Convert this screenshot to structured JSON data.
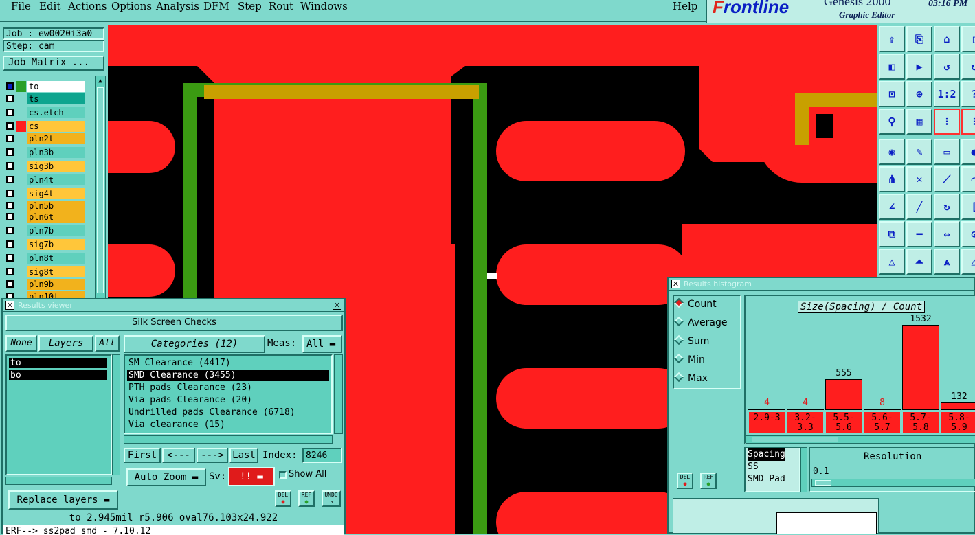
{
  "menu": [
    "File",
    "Edit",
    "Actions",
    "Options",
    "Analysis",
    "DFM",
    "Step",
    "Rout",
    "Windows"
  ],
  "help": "Help",
  "brand": {
    "logo_prefix": "F",
    "logo_rest": "rontline",
    "product": "Genesis 2000",
    "subtitle": "Graphic Editor",
    "time": "03:16 PM"
  },
  "job": {
    "job_label": "Job : ew0020i3a0",
    "step_label": "Step: cam",
    "matrix_button": "Job Matrix ..."
  },
  "layers": [
    {
      "name": "to",
      "color": "#ffffff",
      "swatch": "#2aa02a",
      "active": true
    },
    {
      "name": "ts",
      "color": "#0ea58f",
      "swatch": ""
    },
    {
      "name": "cs.etch",
      "color": "#5fd0bd",
      "swatch": ""
    },
    {
      "name": "cs",
      "color": "#ffc63a",
      "swatch": "#ff1e1e"
    },
    {
      "name": "pln2t",
      "color": "#f2b21c",
      "swatch": ""
    },
    {
      "name": "pln3b",
      "color": "#5fd0bd",
      "swatch": ""
    },
    {
      "name": "sig3b",
      "color": "#ffc63a",
      "swatch": ""
    },
    {
      "name": "pln4t",
      "color": "#5fd0bd",
      "swatch": ""
    },
    {
      "name": "sig4t",
      "color": "#ffc63a",
      "swatch": ""
    },
    {
      "name": "pln5b",
      "color": "#f2b21c",
      "swatch": ""
    },
    {
      "name": "pln6t",
      "color": "#f2b21c",
      "swatch": ""
    },
    {
      "name": "pln7b",
      "color": "#5fd0bd",
      "swatch": ""
    },
    {
      "name": "sig7b",
      "color": "#ffc63a",
      "swatch": ""
    },
    {
      "name": "pln8t",
      "color": "#5fd0bd",
      "swatch": ""
    },
    {
      "name": "sig8t",
      "color": "#ffc63a",
      "swatch": ""
    },
    {
      "name": "pln9b",
      "color": "#f2b21c",
      "swatch": ""
    },
    {
      "name": "pln10t",
      "color": "#f2b21c",
      "swatch": ""
    }
  ],
  "results_viewer": {
    "title": "Results viewer",
    "checks_title": "Silk Screen Checks",
    "none_btn": "None",
    "layers_btn": "Layers",
    "all_btn": "All",
    "layer_list": [
      "to",
      "bo"
    ],
    "categories_label": "Categories (12)",
    "meas_label": "Meas:",
    "meas_value": "All",
    "categories": [
      "SM Clearance (4417)",
      "SMD Clearance (3455)",
      "PTH pads Clearance (23)",
      "Via pads Clearance (20)",
      "Undrilled pads Clearance (6718)",
      "Via clearance (15)"
    ],
    "selected_category": 1,
    "first_btn": "First",
    "prev_btn": "<---",
    "next_btn": "--->",
    "last_btn": "Last",
    "index_label": "Index:",
    "index_value": "8246",
    "auto_zoom": "Auto Zoom",
    "sv_label": "Sv:",
    "sv_value": "!!",
    "show_all": "Show All",
    "replace_layers": "Replace layers",
    "del": "DEL",
    "ref": "REF",
    "undo": "UNDO",
    "status_line": "to 2.945mil  r5.906  oval76.103x24.922",
    "cmd_line": "ERF--> ss2pad_smd - 7.10.12"
  },
  "histogram": {
    "title": "Results histogram",
    "modes": [
      "Count",
      "Average",
      "Sum",
      "Min",
      "Max"
    ],
    "selected_mode": 0,
    "chart_title": "Size(Spacing) / Count",
    "del": "DEL",
    "ref": "REF",
    "measure_list": [
      "Spacing",
      "SS",
      "SMD Pad"
    ],
    "resolution_label": "Resolution",
    "resolution_value": "0.1"
  },
  "chart_data": {
    "type": "bar",
    "title": "Size(Spacing) / Count",
    "categories": [
      "2.9-3",
      "3.2-3.3",
      "5.5-5.6",
      "5.6-5.7",
      "5.7-5.8",
      "5.8-5.9"
    ],
    "values": [
      4,
      4,
      555,
      8,
      1532,
      132
    ],
    "ylim": [
      0,
      1532
    ]
  }
}
